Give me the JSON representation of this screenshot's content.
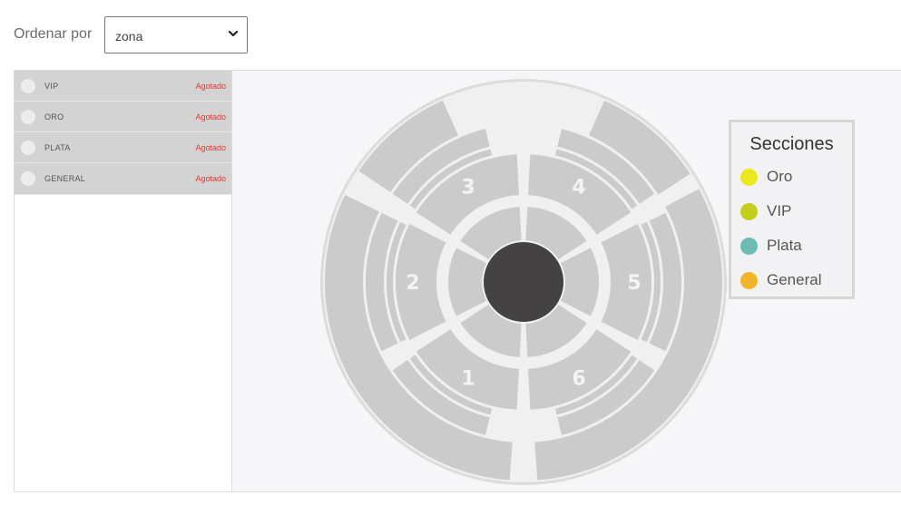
{
  "sort": {
    "label": "Ordenar por",
    "selected": "zona"
  },
  "zones": [
    {
      "name": "VIP",
      "status": "Agotado"
    },
    {
      "name": "ORO",
      "status": "Agotado"
    },
    {
      "name": "PLATA",
      "status": "Agotado"
    },
    {
      "name": "GENERAL",
      "status": "Agotado"
    }
  ],
  "map": {
    "section_numbers": [
      "1",
      "2",
      "3",
      "4",
      "5",
      "6"
    ],
    "colors": {
      "seat": "#cbcbcb",
      "ring": "#f1f0f1",
      "stage": "#444243",
      "edge": "#dcdcdc"
    }
  },
  "legend": {
    "title": "Secciones",
    "items": [
      {
        "label": "Oro",
        "color": "#ece81e"
      },
      {
        "label": "VIP",
        "color": "#c3ce1b"
      },
      {
        "label": "Plata",
        "color": "#6bbdb4"
      },
      {
        "label": "General",
        "color": "#f2b52a"
      }
    ]
  }
}
